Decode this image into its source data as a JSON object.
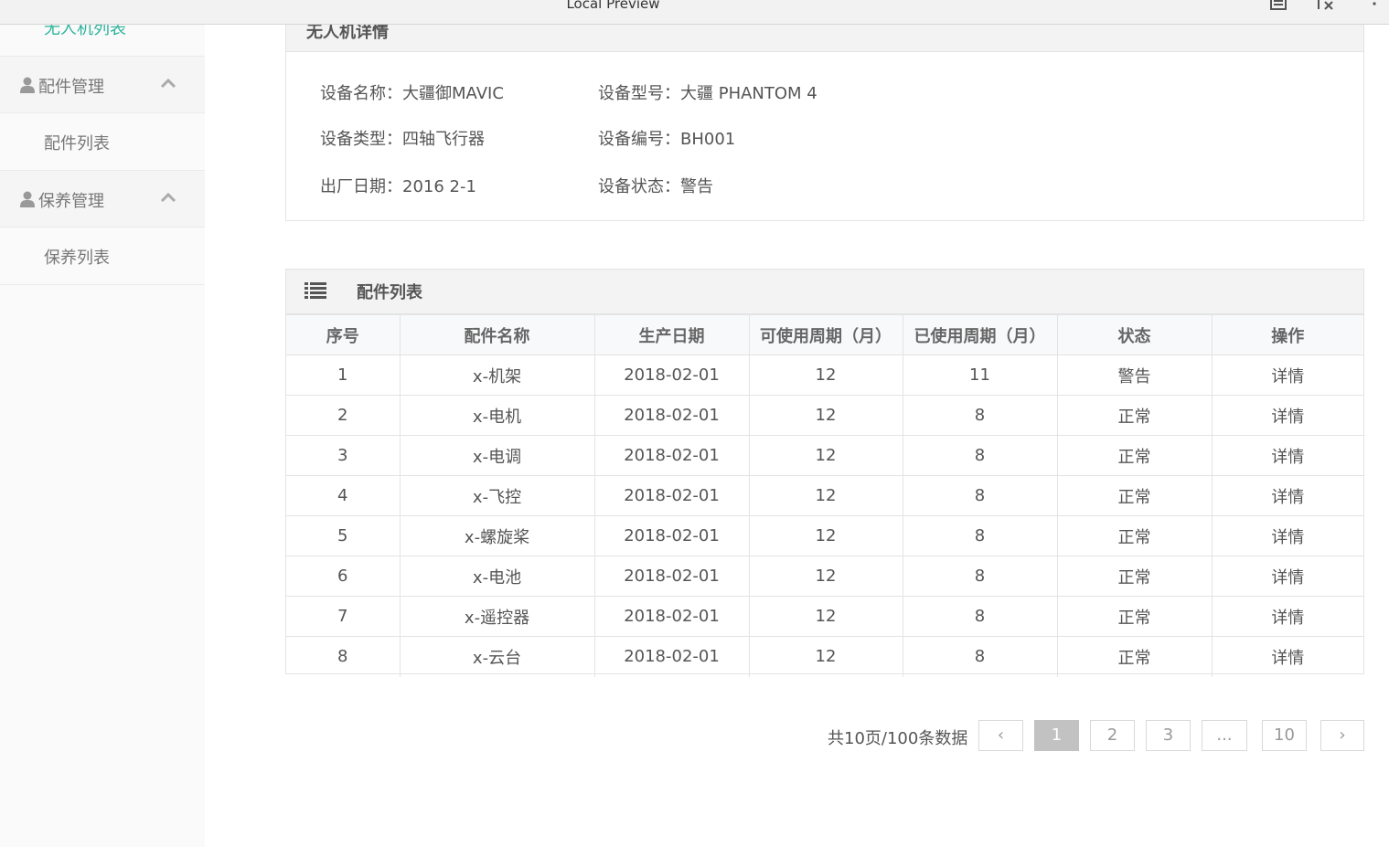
{
  "window": {
    "title": "Local Preview",
    "icons": [
      "document-icon",
      "formula-icon",
      "more-vertical-icon"
    ]
  },
  "sidebar": {
    "top_sub_item": "无人机列表",
    "groups": [
      {
        "label": "配件管理",
        "item": "配件列表"
      },
      {
        "label": "保养管理",
        "item": "保养列表"
      }
    ],
    "accent_color": "#2bb39b"
  },
  "detail": {
    "title": "无人机详情",
    "fields": {
      "name": "设备名称：大疆御MAVIC",
      "model": "设备型号：大疆 PHANTOM 4",
      "type": "设备类型：四轴飞行器",
      "code": "设备编号：BH001",
      "date": "出厂日期：2016 2-1",
      "status": "设备状态：警告"
    }
  },
  "parts": {
    "title": "配件列表",
    "columns": [
      "序号",
      "配件名称",
      "生产日期",
      "可使用周期（月）",
      "已使用周期（月）",
      "状态",
      "操作"
    ],
    "rows": [
      [
        "1",
        "x-机架",
        "2018-02-01",
        "12",
        "11",
        "警告",
        "详情"
      ],
      [
        "2",
        "x-电机",
        "2018-02-01",
        "12",
        "8",
        "正常",
        "详情"
      ],
      [
        "3",
        "x-电调",
        "2018-02-01",
        "12",
        "8",
        "正常",
        "详情"
      ],
      [
        "4",
        "x-飞控",
        "2018-02-01",
        "12",
        "8",
        "正常",
        "详情"
      ],
      [
        "5",
        "x-螺旋桨",
        "2018-02-01",
        "12",
        "8",
        "正常",
        "详情"
      ],
      [
        "6",
        "x-电池",
        "2018-02-01",
        "12",
        "8",
        "正常",
        "详情"
      ],
      [
        "7",
        "x-遥控器",
        "2018-02-01",
        "12",
        "8",
        "正常",
        "详情"
      ],
      [
        "8",
        "x-云台",
        "2018-02-01",
        "12",
        "8",
        "正常",
        "详情"
      ]
    ]
  },
  "pagination": {
    "total": "共10页/100条数据",
    "prev": "‹",
    "pages": [
      "1",
      "2",
      "3",
      "...",
      "10"
    ],
    "current": "1",
    "next": "›"
  }
}
